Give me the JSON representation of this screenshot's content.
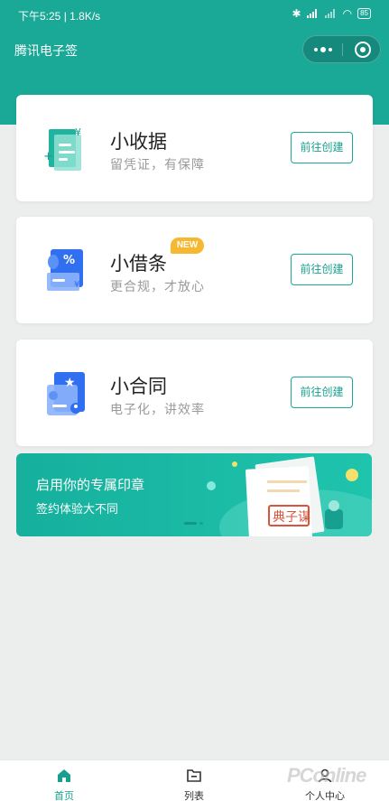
{
  "status_bar": {
    "time": "下午5:25 | 1.8K/s",
    "battery": "85"
  },
  "app_bar": {
    "title": "腾讯电子签"
  },
  "cards": [
    {
      "title": "小收据",
      "subtitle": "留凭证，有保障",
      "button": "前往创建",
      "icon": "receipt-icon"
    },
    {
      "title": "小借条",
      "subtitle": "更合规，才放心",
      "button": "前往创建",
      "icon": "loan-note-icon",
      "badge": "NEW"
    },
    {
      "title": "小合同",
      "subtitle": "电子化，讲效率",
      "button": "前往创建",
      "icon": "contract-icon"
    }
  ],
  "banner": {
    "line1": "启用你的专属印章",
    "line2": "签约体验大不同",
    "seal_text": "典子谋"
  },
  "tabbar": {
    "items": [
      {
        "label": "首页",
        "icon": "home-icon",
        "active": true
      },
      {
        "label": "列表",
        "icon": "folder-icon",
        "active": false
      },
      {
        "label": "个人中心",
        "icon": "person-icon",
        "active": false
      }
    ]
  },
  "watermark": "PConline",
  "colors": {
    "primary": "#1aa897",
    "badge": "#f6b830",
    "background": "#eceeee"
  }
}
